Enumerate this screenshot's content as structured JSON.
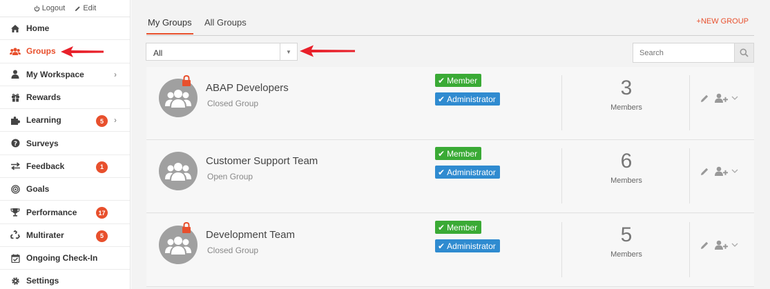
{
  "top_links": {
    "logout": "Logout",
    "edit": "Edit"
  },
  "sidebar": {
    "items": [
      {
        "label": "Home",
        "icon": "home-icon"
      },
      {
        "label": "Groups",
        "icon": "users-icon",
        "active": true
      },
      {
        "label": "My Workspace",
        "icon": "user-icon",
        "chevron": true
      },
      {
        "label": "Rewards",
        "icon": "gift-icon"
      },
      {
        "label": "Learning",
        "icon": "puzzle-icon",
        "badge": "5",
        "chevron": true
      },
      {
        "label": "Surveys",
        "icon": "question-icon"
      },
      {
        "label": "Feedback",
        "icon": "exchange-icon",
        "badge": "1"
      },
      {
        "label": "Goals",
        "icon": "target-icon"
      },
      {
        "label": "Performance",
        "icon": "trophy-icon",
        "badge": "17"
      },
      {
        "label": "Multirater",
        "icon": "recycle-icon",
        "badge": "5"
      },
      {
        "label": "Ongoing Check-In",
        "icon": "calendar-check-icon"
      },
      {
        "label": "Settings",
        "icon": "gear-icon"
      }
    ]
  },
  "tabs": {
    "my_groups": "My Groups",
    "all_groups": "All Groups"
  },
  "new_group": "+NEW GROUP",
  "filter": {
    "value": "All"
  },
  "search": {
    "placeholder": "Search"
  },
  "groups": [
    {
      "name": "ABAP Developers",
      "type": "Closed Group",
      "count": "3",
      "count_label": "Members",
      "member_tag": "Member",
      "admin_tag": "Administrator",
      "locked": true
    },
    {
      "name": "Customer Support Team",
      "type": "Open Group",
      "count": "6",
      "count_label": "Members",
      "member_tag": "Member",
      "admin_tag": "Administrator",
      "locked": false
    },
    {
      "name": "Development Team",
      "type": "Closed Group",
      "count": "5",
      "count_label": "Members",
      "member_tag": "Member",
      "admin_tag": "Administrator",
      "locked": true
    }
  ],
  "colors": {
    "accent": "#e8502d",
    "member": "#3aaa35",
    "admin": "#2f8bd0",
    "annotation_arrow": "#e8202a"
  }
}
